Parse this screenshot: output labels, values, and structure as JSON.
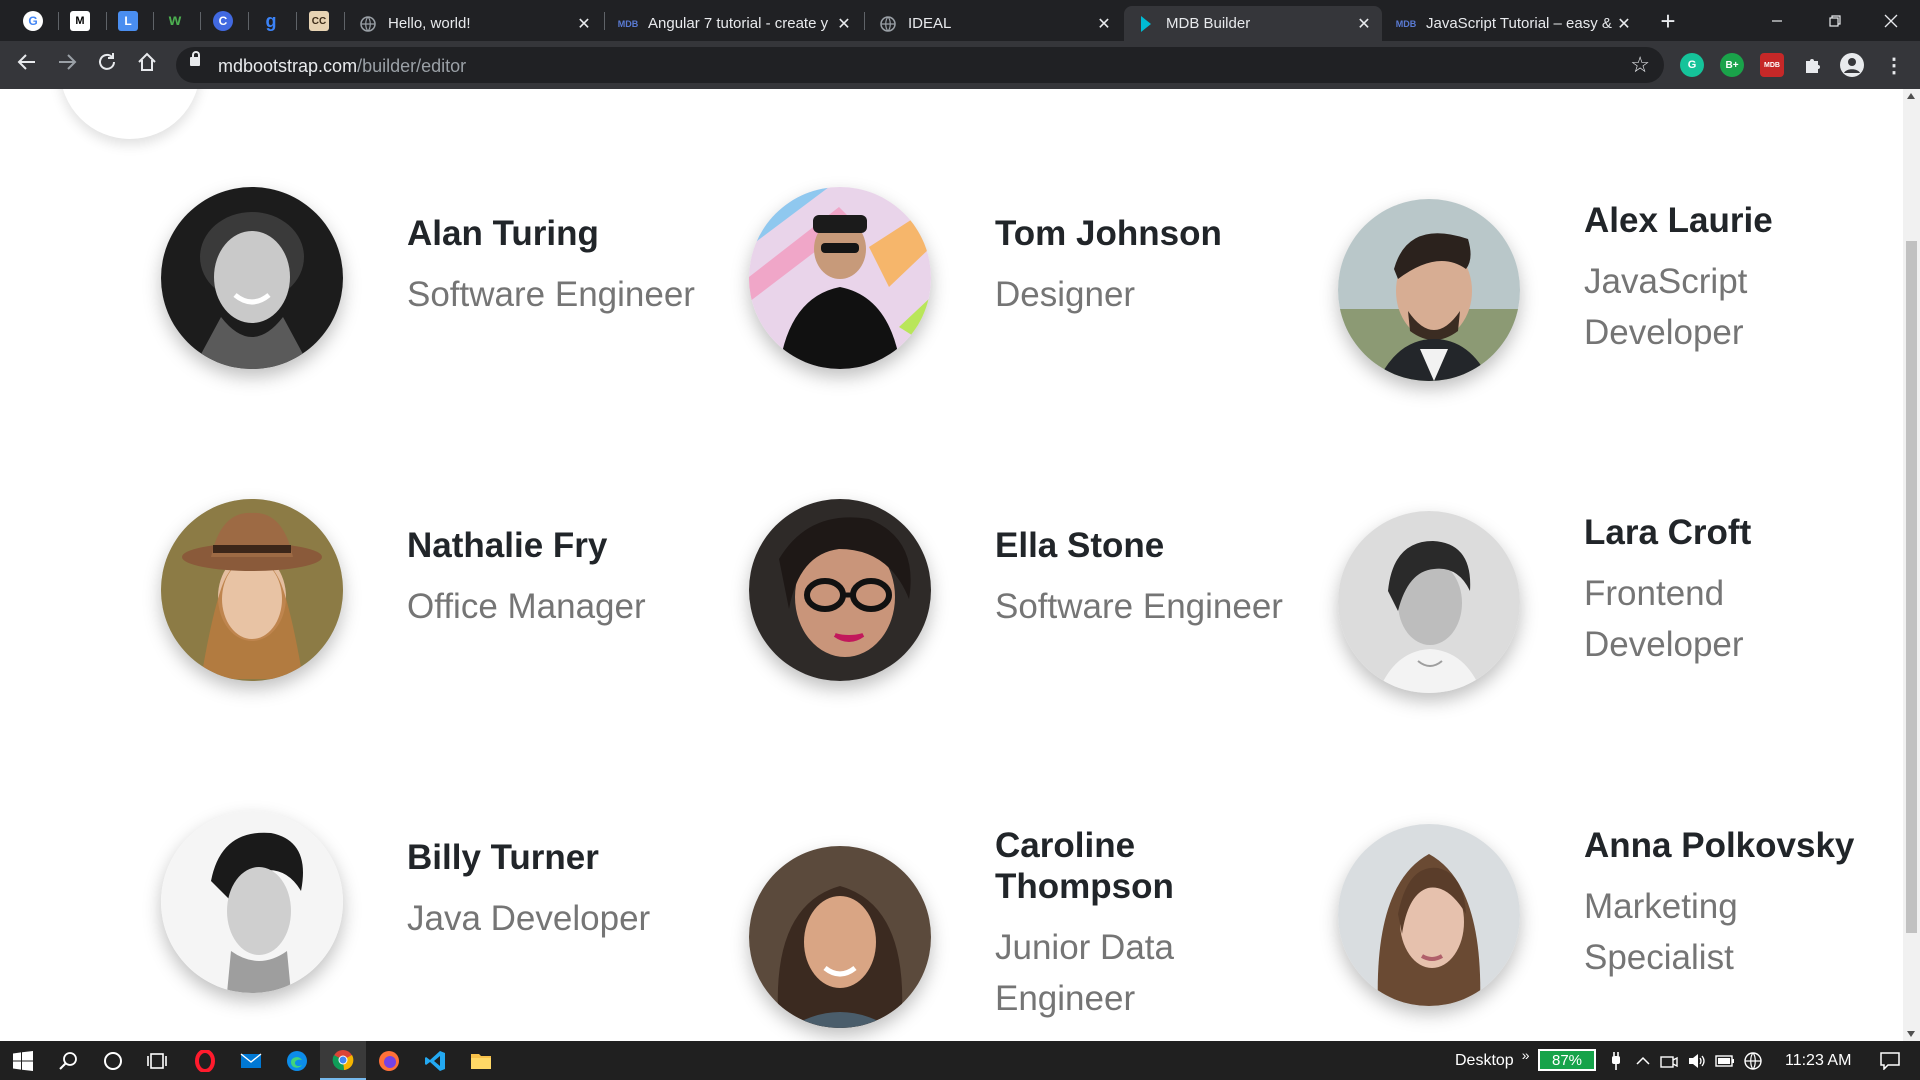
{
  "browser": {
    "tabs": [
      {
        "title": "Hello, world!",
        "favicon": "globe-icon"
      },
      {
        "title": "Angular 7 tutorial - create y",
        "favicon": "mdb-icon"
      },
      {
        "title": "IDEAL",
        "favicon": "globe-icon"
      },
      {
        "title": "MDB Builder",
        "favicon": "mdb-builder-icon",
        "active": true
      },
      {
        "title": "JavaScript Tutorial – easy &",
        "favicon": "mdb-icon"
      }
    ],
    "url_host": "mdbootstrap.com",
    "url_path": "/builder/editor",
    "ext_badges": {
      "bplus": "B+",
      "mdb": "MDB"
    }
  },
  "team": [
    {
      "name": "Alan Turing",
      "role": "Software Engineer"
    },
    {
      "name": "Tom Johnson",
      "role": "Designer"
    },
    {
      "name": "Alex Laurie",
      "role_lines": [
        "JavaScript",
        "Developer"
      ]
    },
    {
      "name": "Nathalie Fry",
      "role": "Office Manager"
    },
    {
      "name": "Ella Stone",
      "role": "Software Engineer"
    },
    {
      "name": "Lara Croft",
      "role_lines": [
        "Frontend",
        "Developer"
      ]
    },
    {
      "name": "Billy Turner",
      "role": "Java Developer"
    },
    {
      "name_lines": [
        "Caroline",
        "Thompson"
      ],
      "role_lines": [
        "Junior Data",
        "Engineer"
      ]
    },
    {
      "name": "Anna Polkovsky",
      "role_lines": [
        "Marketing",
        "Specialist"
      ]
    }
  ],
  "taskbar": {
    "desktop_label": "Desktop",
    "battery": "87%",
    "time": "11:23 AM"
  },
  "colors": {
    "name": "#212529",
    "role": "#757575",
    "chrome_dark": "#202124",
    "chrome_toolbar": "#35363a",
    "battery_green": "#16a34a"
  }
}
